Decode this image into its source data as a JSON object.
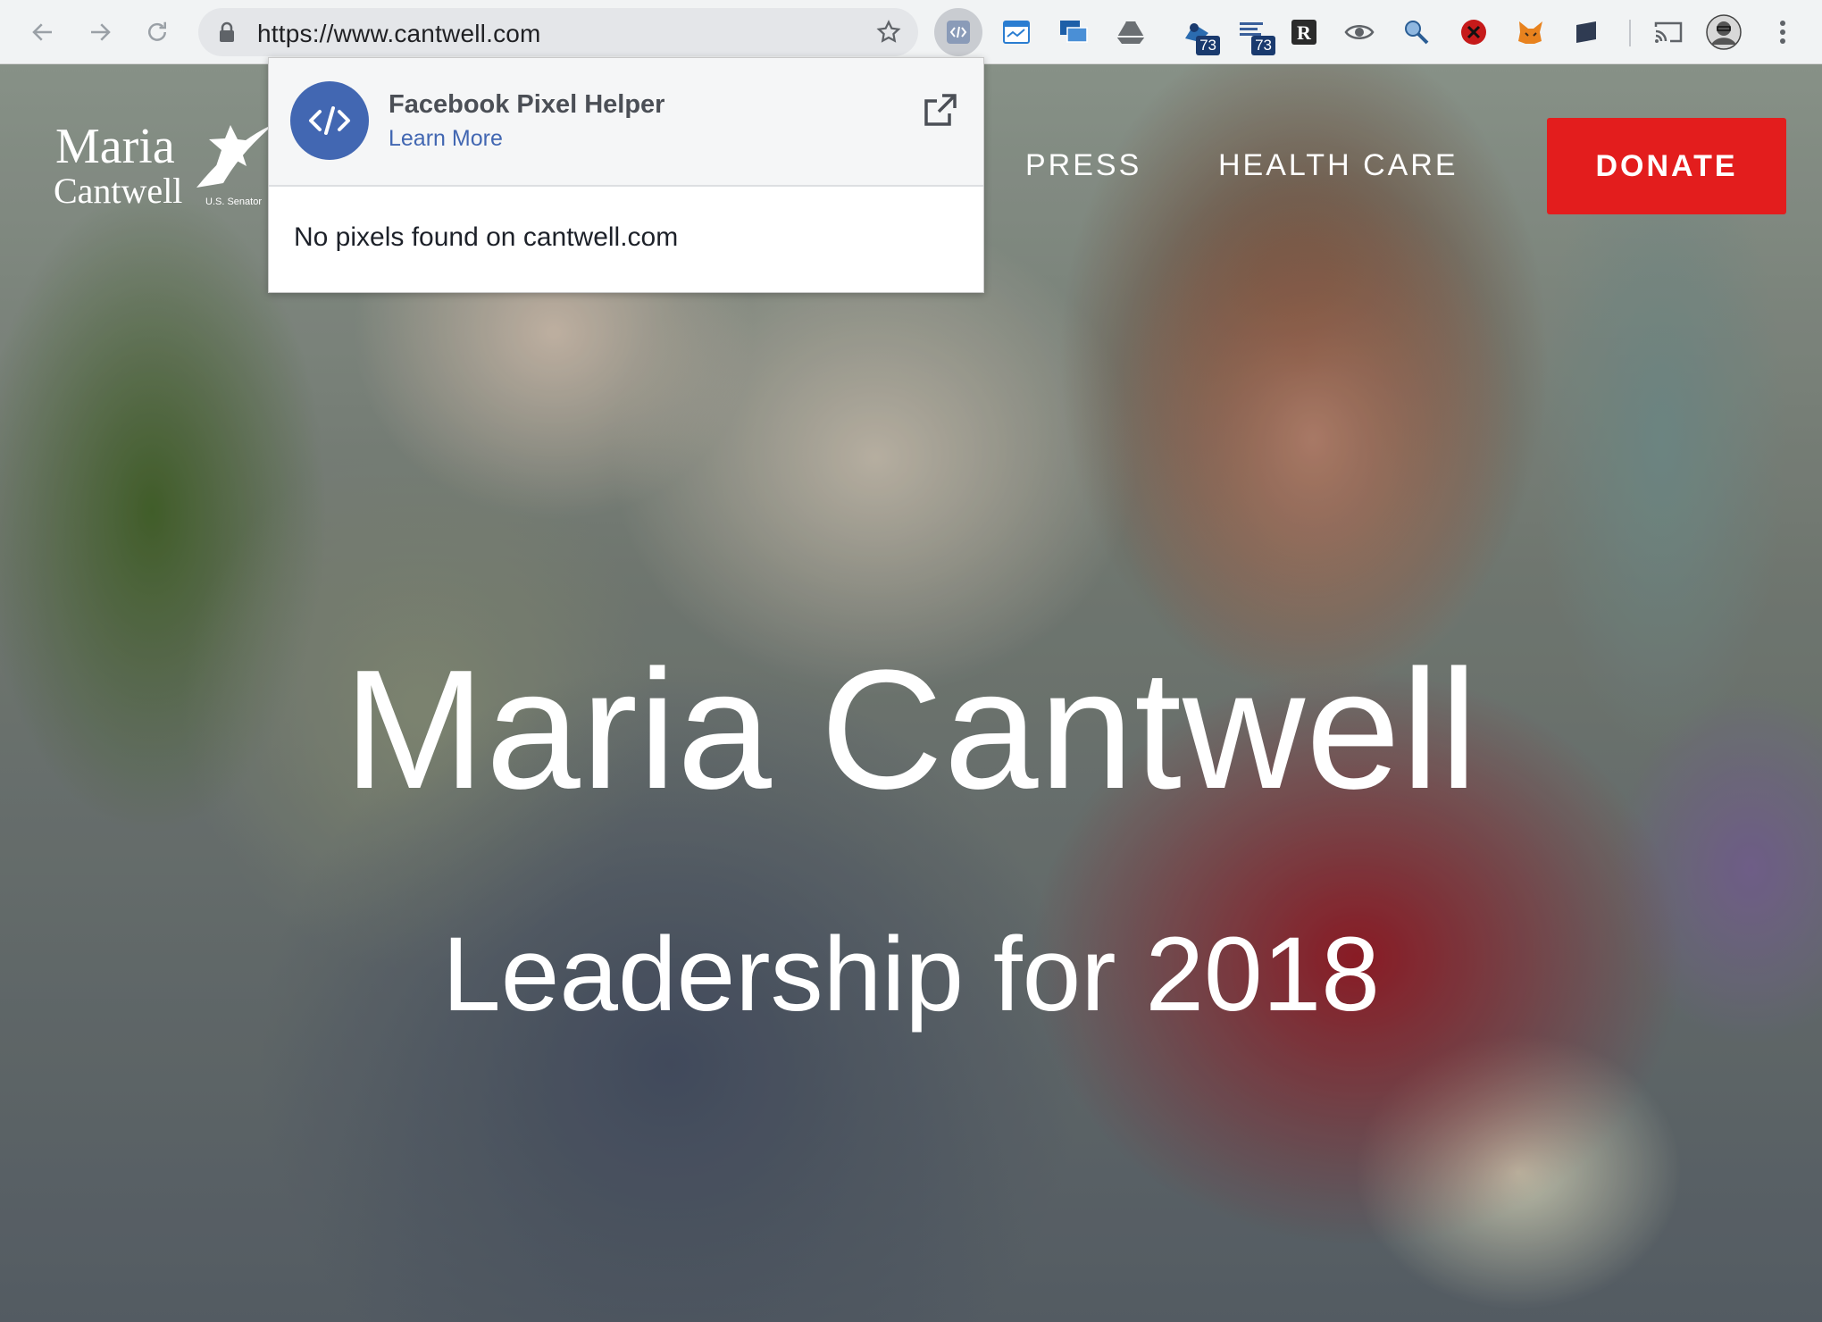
{
  "browser": {
    "url": "https://www.cantwell.com",
    "extension_badge_1": "73",
    "extension_badge_2": "73",
    "icons": [
      "back-arrow-icon",
      "forward-arrow-icon",
      "reload-icon",
      "lock-icon",
      "bookmark-star-icon",
      "pixel-helper-icon",
      "cast-icon",
      "profile-avatar",
      "more-menu-icon"
    ]
  },
  "popup": {
    "title": "Facebook Pixel Helper",
    "learn_more": "Learn More",
    "message": "No pixels found on cantwell.com"
  },
  "site": {
    "logo_first": "Maria",
    "logo_last": "Cantwell",
    "logo_sub": "U.S. Senator",
    "nav": [
      "PRESS",
      "HEALTH CARE"
    ],
    "donate": "DONATE",
    "hero_title": "Maria Cantwell",
    "hero_subtitle": "Leadership for 2018"
  },
  "colors": {
    "donate": "#e31d1d",
    "facebook_blue": "#4267b2"
  }
}
